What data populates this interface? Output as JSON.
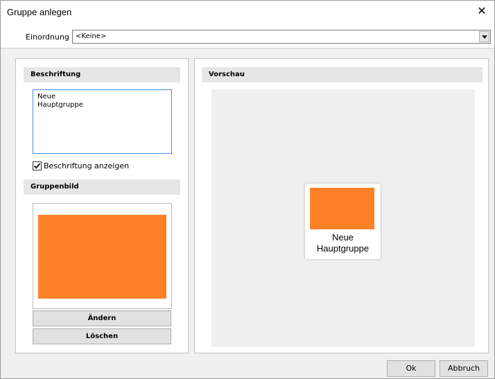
{
  "window": {
    "title": "Gruppe anlegen",
    "close_glyph": "✕"
  },
  "einordnung": {
    "label": "Einordnung",
    "value": "<Keine>"
  },
  "beschriftung": {
    "header": "Beschriftung",
    "text": "Neue\nHauptgruppe",
    "show_label": "Beschriftung anzeigen",
    "show_checked": true
  },
  "gruppenbild": {
    "header": "Gruppenbild",
    "color": "#ff8127",
    "change_button": "Ändern",
    "delete_button": "Löschen"
  },
  "vorschau": {
    "header": "Vorschau",
    "tile_color": "#ff8127",
    "tile_caption": "Neue\nHauptgruppe"
  },
  "footer": {
    "ok_button": "Ok",
    "cancel_button": "Abbruch"
  }
}
